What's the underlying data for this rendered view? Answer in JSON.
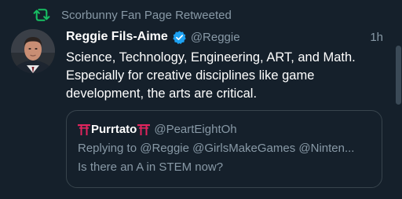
{
  "retweet": {
    "icon": "retweet-icon",
    "text": "Scorbunny Fan Page Retweeted",
    "color": "#17bf63"
  },
  "tweet": {
    "avatar_icon": "avatar",
    "name": "Reggie Fils-Aime",
    "verified_icon": "verified-badge-icon",
    "handle": "@Reggie",
    "time": "1h",
    "lines": [
      "Science, Technology, Engineering, ART, and Math.",
      "Especially for creative disciplines like game",
      "development, the arts are critical."
    ]
  },
  "quote": {
    "name_prefix_icon": "torii-gate-icon",
    "name": "Purrtato",
    "name_suffix_icon": "torii-gate-icon",
    "handle": "@PeartEightOh",
    "reply_line": "Replying to @Reggie @GirlsMakeGames @Ninten...",
    "text": "Is there an A in STEM now?"
  },
  "colors": {
    "background": "#15202b",
    "primary_text": "#ffffff",
    "secondary_text": "#8899a6",
    "accent": "#1da1f2",
    "border": "#38444d"
  }
}
